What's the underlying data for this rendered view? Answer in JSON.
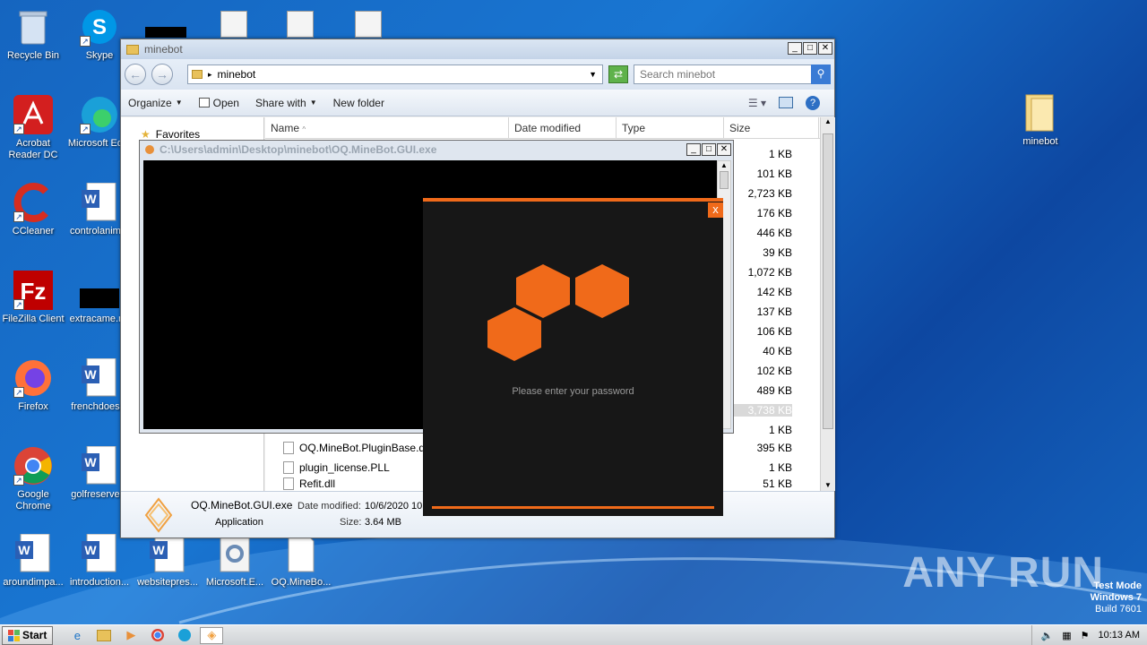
{
  "desktop": {
    "icons": [
      {
        "label": "Recycle Bin",
        "icon": "recycle-bin-icon"
      },
      {
        "label": "Skype",
        "icon": "skype-icon"
      },
      {
        "label": "Acrobat Reader DC",
        "icon": "acrobat-icon"
      },
      {
        "label": "Microsoft Ed...",
        "icon": "edge-icon"
      },
      {
        "label": "CCleaner",
        "icon": "ccleaner-icon"
      },
      {
        "label": "controlanim...",
        "icon": "word-doc-icon"
      },
      {
        "label": "FileZilla Client",
        "icon": "filezilla-icon"
      },
      {
        "label": "extracame.r...",
        "icon": "black-file-icon"
      },
      {
        "label": "Firefox",
        "icon": "firefox-icon"
      },
      {
        "label": "frenchdoes...",
        "icon": "word-doc-icon"
      },
      {
        "label": "Google Chrome",
        "icon": "chrome-icon"
      },
      {
        "label": "golfreserve...",
        "icon": "word-doc-icon"
      },
      {
        "label": "aroundimpa...",
        "icon": "word-doc-icon"
      },
      {
        "label": "introduction...",
        "icon": "word-doc-icon"
      },
      {
        "label": "websitepres...",
        "icon": "word-doc-icon"
      },
      {
        "label": "Microsoft.E...",
        "icon": "gear-file-icon"
      },
      {
        "label": "OQ.MineBo...",
        "icon": "blank-file-icon"
      },
      {
        "label": "minebot",
        "icon": "folder-icon"
      }
    ]
  },
  "explorer": {
    "title": "minebot",
    "address": "minebot",
    "search_placeholder": "Search minebot",
    "toolbar": {
      "organize": "Organize",
      "open": "Open",
      "share_with": "Share with",
      "new_folder": "New folder"
    },
    "nav": {
      "favorites": "Favorites"
    },
    "columns": {
      "name": "Name",
      "date": "Date modified",
      "type": "Type",
      "size": "Size"
    },
    "sizes": [
      "1 KB",
      "101 KB",
      "2,723 KB",
      "176 KB",
      "446 KB",
      "39 KB",
      "1,072 KB",
      "142 KB",
      "137 KB",
      "106 KB",
      "40 KB",
      "102 KB",
      "489 KB",
      "3,738 KB",
      "1 KB"
    ],
    "files": [
      {
        "name": "OQ.MineBot.PluginBase.dll",
        "size": "395 KB"
      },
      {
        "name": "plugin_license.PLL",
        "size": "1 KB"
      },
      {
        "name": "Refit.dll",
        "size": "51 KB"
      }
    ],
    "details": {
      "filename": "OQ.MineBot.GUI.exe",
      "date_label": "Date modified:",
      "date_value": "10/6/2020 10",
      "type": "Application",
      "size_label": "Size:",
      "size_value": "3.64 MB"
    }
  },
  "console": {
    "title": "C:\\Users\\admin\\Desktop\\minebot\\OQ.MineBot.GUI.exe"
  },
  "dialog": {
    "prompt": "Please enter your password",
    "close": "x",
    "accent": "#f06a1a"
  },
  "taskbar": {
    "start": "Start",
    "time": "10:13 AM"
  },
  "watermark": "ANY RUN",
  "test_mode": {
    "line1": "Test Mode",
    "line2": "Windows 7",
    "line3": "Build 7601"
  }
}
